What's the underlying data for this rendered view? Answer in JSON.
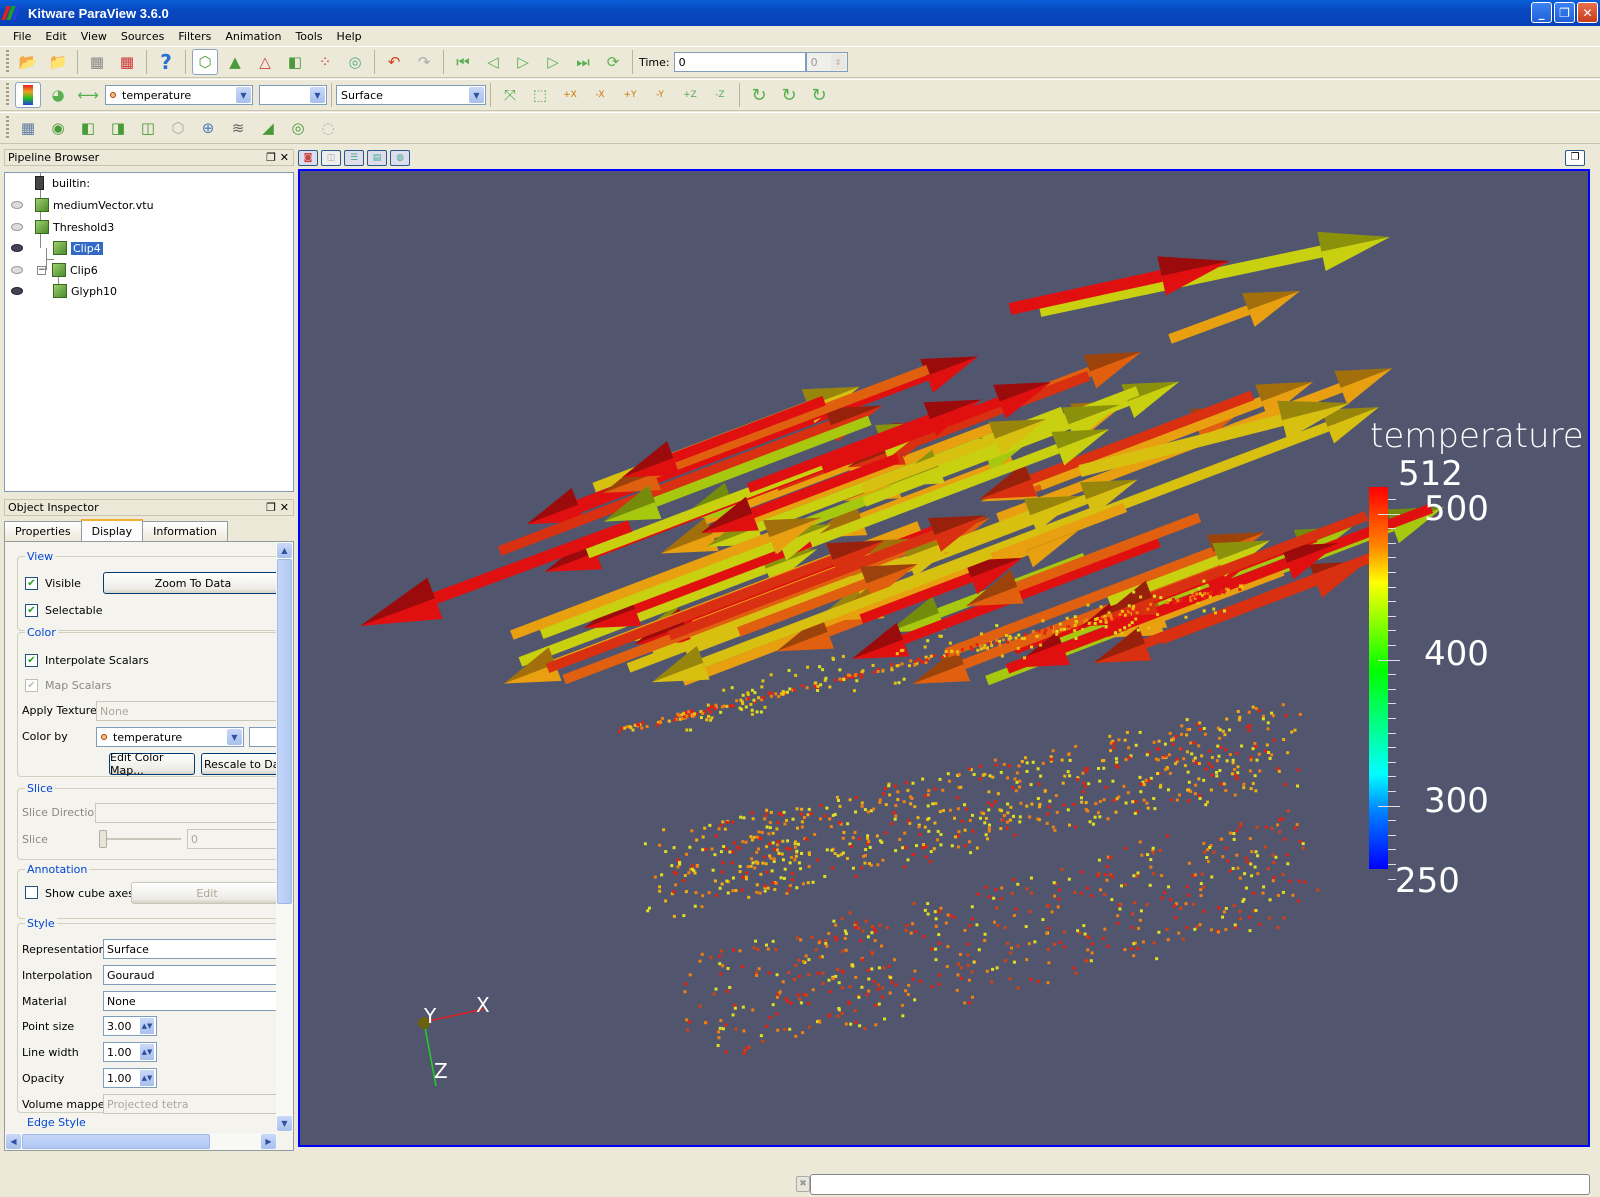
{
  "window": {
    "title": "Kitware ParaView 3.6.0"
  },
  "menu": [
    "File",
    "Edit",
    "View",
    "Sources",
    "Filters",
    "Animation",
    "Tools",
    "Help"
  ],
  "toolbar1": {
    "icons": [
      "open-file-icon",
      "load-state-icon",
      "connect-icon",
      "disconnect-icon",
      "help-icon",
      "select-cells-icon",
      "select-points-icon",
      "select-frustum-icon",
      "select-frustum-cells-icon",
      "select-block-icon",
      "pick-center-icon",
      "undo-icon",
      "redo-icon",
      "first-frame-icon",
      "previous-frame-icon",
      "play-icon",
      "next-frame-icon",
      "last-frame-icon",
      "loop-icon"
    ],
    "time_label": "Time:",
    "time_value": "0",
    "time_step": "0"
  },
  "toolbar2": {
    "color_by": "temperature",
    "component": "",
    "representation": "Surface",
    "camera_buttons": [
      "+X",
      "-X",
      "+Y",
      "-Y",
      "+Z",
      "-Z"
    ]
  },
  "toolbar3": {
    "filters": [
      "calculator-icon",
      "contour-icon",
      "clip-icon",
      "slice-icon",
      "threshold-icon",
      "extract-subset-icon",
      "glyph-icon",
      "stream-tracer-icon",
      "warp-vector-icon",
      "group-datasets-icon",
      "extract-level-icon"
    ]
  },
  "pipeline": {
    "title": "Pipeline Browser",
    "items": [
      {
        "label": "builtin:",
        "visible": null,
        "selected": false
      },
      {
        "label": "mediumVector.vtu",
        "visible": false,
        "selected": false
      },
      {
        "label": "Threshold3",
        "visible": false,
        "selected": false
      },
      {
        "label": "Clip4",
        "visible": true,
        "selected": true
      },
      {
        "label": "Clip6",
        "visible": false,
        "selected": false
      },
      {
        "label": "Glyph10",
        "visible": true,
        "selected": false
      }
    ]
  },
  "inspector": {
    "title": "Object Inspector",
    "tabs": [
      "Properties",
      "Display",
      "Information"
    ],
    "active_tab": "Display",
    "view": {
      "label": "View",
      "visible_label": "Visible",
      "visible": true,
      "selectable_label": "Selectable",
      "selectable": true,
      "zoom_button": "Zoom To Data"
    },
    "color": {
      "label": "Color",
      "interpolate_label": "Interpolate Scalars",
      "interpolate": true,
      "map_label": "Map Scalars",
      "map": true,
      "texture_label": "Apply Texture",
      "texture_value": "None",
      "color_by_label": "Color by",
      "color_by_value": "temperature",
      "edit_button": "Edit Color Map...",
      "rescale_button": "Rescale to Dat"
    },
    "slice": {
      "label": "Slice",
      "direction_label": "Slice Direction",
      "direction_value": "",
      "slice_label": "Slice",
      "slice_value": "0"
    },
    "annotation": {
      "label": "Annotation",
      "cube_axes_label": "Show cube axes",
      "cube_axes": false,
      "edit_button": "Edit"
    },
    "style": {
      "label": "Style",
      "representation_label": "Representation",
      "representation": "Surface",
      "interpolation_label": "Interpolation",
      "interpolation": "Gouraud",
      "material_label": "Material",
      "material": "None",
      "point_size_label": "Point size",
      "point_size": "3.00",
      "line_width_label": "Line width",
      "line_width": "1.00",
      "opacity_label": "Opacity",
      "opacity": "1.00",
      "volume_mapper_label": "Volume mapper",
      "volume_mapper": "Projected tetra"
    },
    "edge_style": {
      "label": "Edge Style"
    }
  },
  "render_view": {
    "background": "#51566e",
    "legend": {
      "title": "temperature",
      "max": "512",
      "min": "250",
      "ticks": [
        "500",
        "400",
        "300"
      ],
      "range": [
        250,
        512
      ]
    },
    "axes": {
      "x": "X",
      "y": "Y",
      "z": "Z"
    }
  },
  "statusbar": {
    "text": ""
  }
}
